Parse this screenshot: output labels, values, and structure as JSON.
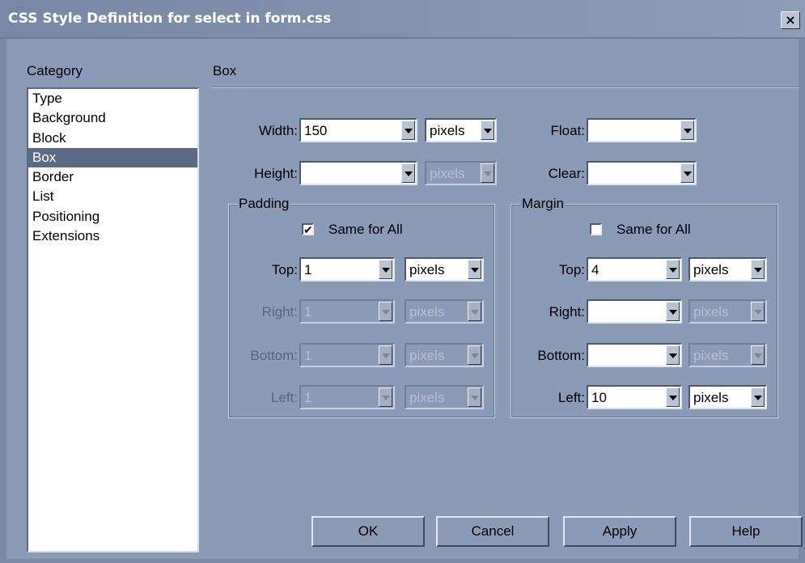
{
  "window": {
    "title": "CSS Style Definition for select in form.css",
    "close_label": "×"
  },
  "category": {
    "label": "Category",
    "items": [
      "Type",
      "Background",
      "Block",
      "Box",
      "Border",
      "List",
      "Positioning",
      "Extensions"
    ],
    "selected": "Box"
  },
  "section": {
    "title": "Box"
  },
  "box": {
    "width": {
      "label": "Width:",
      "value": "150",
      "unit": "pixels"
    },
    "height": {
      "label": "Height:",
      "value": "",
      "unit": "pixels"
    },
    "float": {
      "label": "Float:",
      "value": ""
    },
    "clear": {
      "label": "Clear:",
      "value": ""
    }
  },
  "padding": {
    "label": "Padding",
    "same_for_all_label": "Same for All",
    "same_for_all_checked": true,
    "check_mark": "✔",
    "top": {
      "label": "Top:",
      "value": "1",
      "unit": "pixels"
    },
    "right": {
      "label": "Right:",
      "value": "1",
      "unit": "pixels"
    },
    "bottom": {
      "label": "Bottom:",
      "value": "1",
      "unit": "pixels"
    },
    "left": {
      "label": "Left:",
      "value": "1",
      "unit": "pixels"
    }
  },
  "margin": {
    "label": "Margin",
    "same_for_all_label": "Same for All",
    "same_for_all_checked": false,
    "top": {
      "label": "Top:",
      "value": "4",
      "unit": "pixels"
    },
    "right": {
      "label": "Right:",
      "value": "",
      "unit": "pixels"
    },
    "bottom": {
      "label": "Bottom:",
      "value": "",
      "unit": "pixels"
    },
    "left": {
      "label": "Left:",
      "value": "10",
      "unit": "pixels"
    }
  },
  "buttons": {
    "ok": "OK",
    "cancel": "Cancel",
    "apply": "Apply",
    "help": "Help"
  },
  "colors": {
    "background": "#8a9bb5",
    "selection": "#5b6b85",
    "title_text": "#ffffff"
  }
}
